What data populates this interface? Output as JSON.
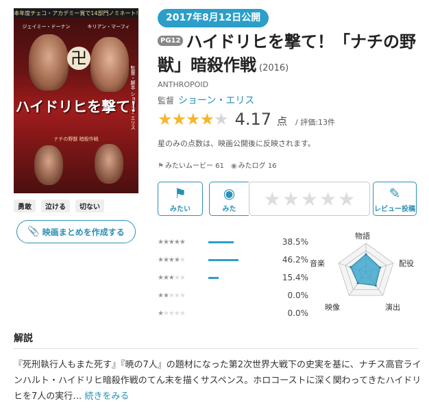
{
  "poster": {
    "tagline": "本年度チェコ・アカデミー賞で14部門ノミネート!",
    "cast1": "ジェイミー・ドーナン",
    "cast2": "キリアン・マーフィ",
    "title_art": "ハイドリヒを撃て!",
    "subtitle_art": "ナチの野獣 暗殺作戦",
    "credit": "監督・脚本 ショーン・エリス"
  },
  "tags": [
    "勇敢",
    "泣ける",
    "切ない"
  ],
  "matome_button": "映画まとめを作成する",
  "release_date": "2017年8月12日公開",
  "rating_badge": "PG12",
  "title": "ハイドリヒを撃て！「ナチの野獣」暗殺作戦",
  "year": "(2016)",
  "english_title": "ANTHROPOID",
  "director_label": "監督",
  "director_name": "ショーン・エリス",
  "score": {
    "value": "4.17",
    "unit": "点",
    "count_text": "/ 評価:13件",
    "stars": 4.17
  },
  "note": "星のみの点数は、映画公開後に反映されます。",
  "stats": {
    "want_label": "みたいムービー",
    "want_count": "61",
    "log_label": "みたログ",
    "log_count": "16"
  },
  "actions": {
    "want": "みたい",
    "seen": "みた",
    "review": "レビュー投稿"
  },
  "chart_data": [
    {
      "type": "bar",
      "categories": [
        "★5",
        "★4",
        "★3",
        "★2",
        "★1"
      ],
      "values": [
        38.5,
        46.2,
        15.4,
        0.0,
        0.0
      ],
      "labels": [
        "38.5%",
        "46.2%",
        "15.4%",
        "0.0%",
        "0.0%"
      ],
      "ylim": [
        0,
        100
      ]
    },
    {
      "type": "radar",
      "categories": [
        "物語",
        "配役",
        "演出",
        "映像",
        "音楽"
      ],
      "values": [
        0.62,
        0.52,
        0.58,
        0.48,
        0.56
      ]
    }
  ],
  "description": {
    "heading": "解説",
    "text": "『死刑執行人もまた死す』『暁の7人』の題材になった第2次世界大戦下の史実を基に、ナチス高官ラインハルト・ハイドリヒ暗殺作戦のてん末を描くサスペンス。ホロコーストに深く関わってきたハイドリヒを7人の実行…",
    "more": "続きをみる"
  },
  "colors": {
    "accent": "#2b9ec9",
    "star": "#f5b62b"
  }
}
